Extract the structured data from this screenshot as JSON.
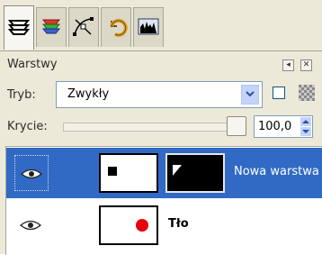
{
  "colors": {
    "selection": "#316ac5",
    "panel": "#ece9d8",
    "red_dot": "#e8000b"
  },
  "tabs": [
    {
      "icon": "layers-icon",
      "active": true
    },
    {
      "icon": "channels-icon",
      "active": false
    },
    {
      "icon": "paths-icon",
      "active": false
    },
    {
      "icon": "undo-history-icon",
      "active": false
    },
    {
      "icon": "histogram-icon",
      "active": false
    }
  ],
  "panel": {
    "title": "Warstwy",
    "mode_label": "Tryb:",
    "mode_value": "Zwykły",
    "opacity_label": "Krycie:",
    "opacity_value": "100,0",
    "opacity_percent": 100
  },
  "layers": [
    {
      "name": "Nowa warstwa",
      "visible": true,
      "selected": true,
      "thumb_icon": "black-square-icon",
      "mask_icon": "white-corner-icon"
    },
    {
      "name": "Tło",
      "visible": true,
      "selected": false,
      "thumb_icon": "red-dot-icon"
    }
  ]
}
